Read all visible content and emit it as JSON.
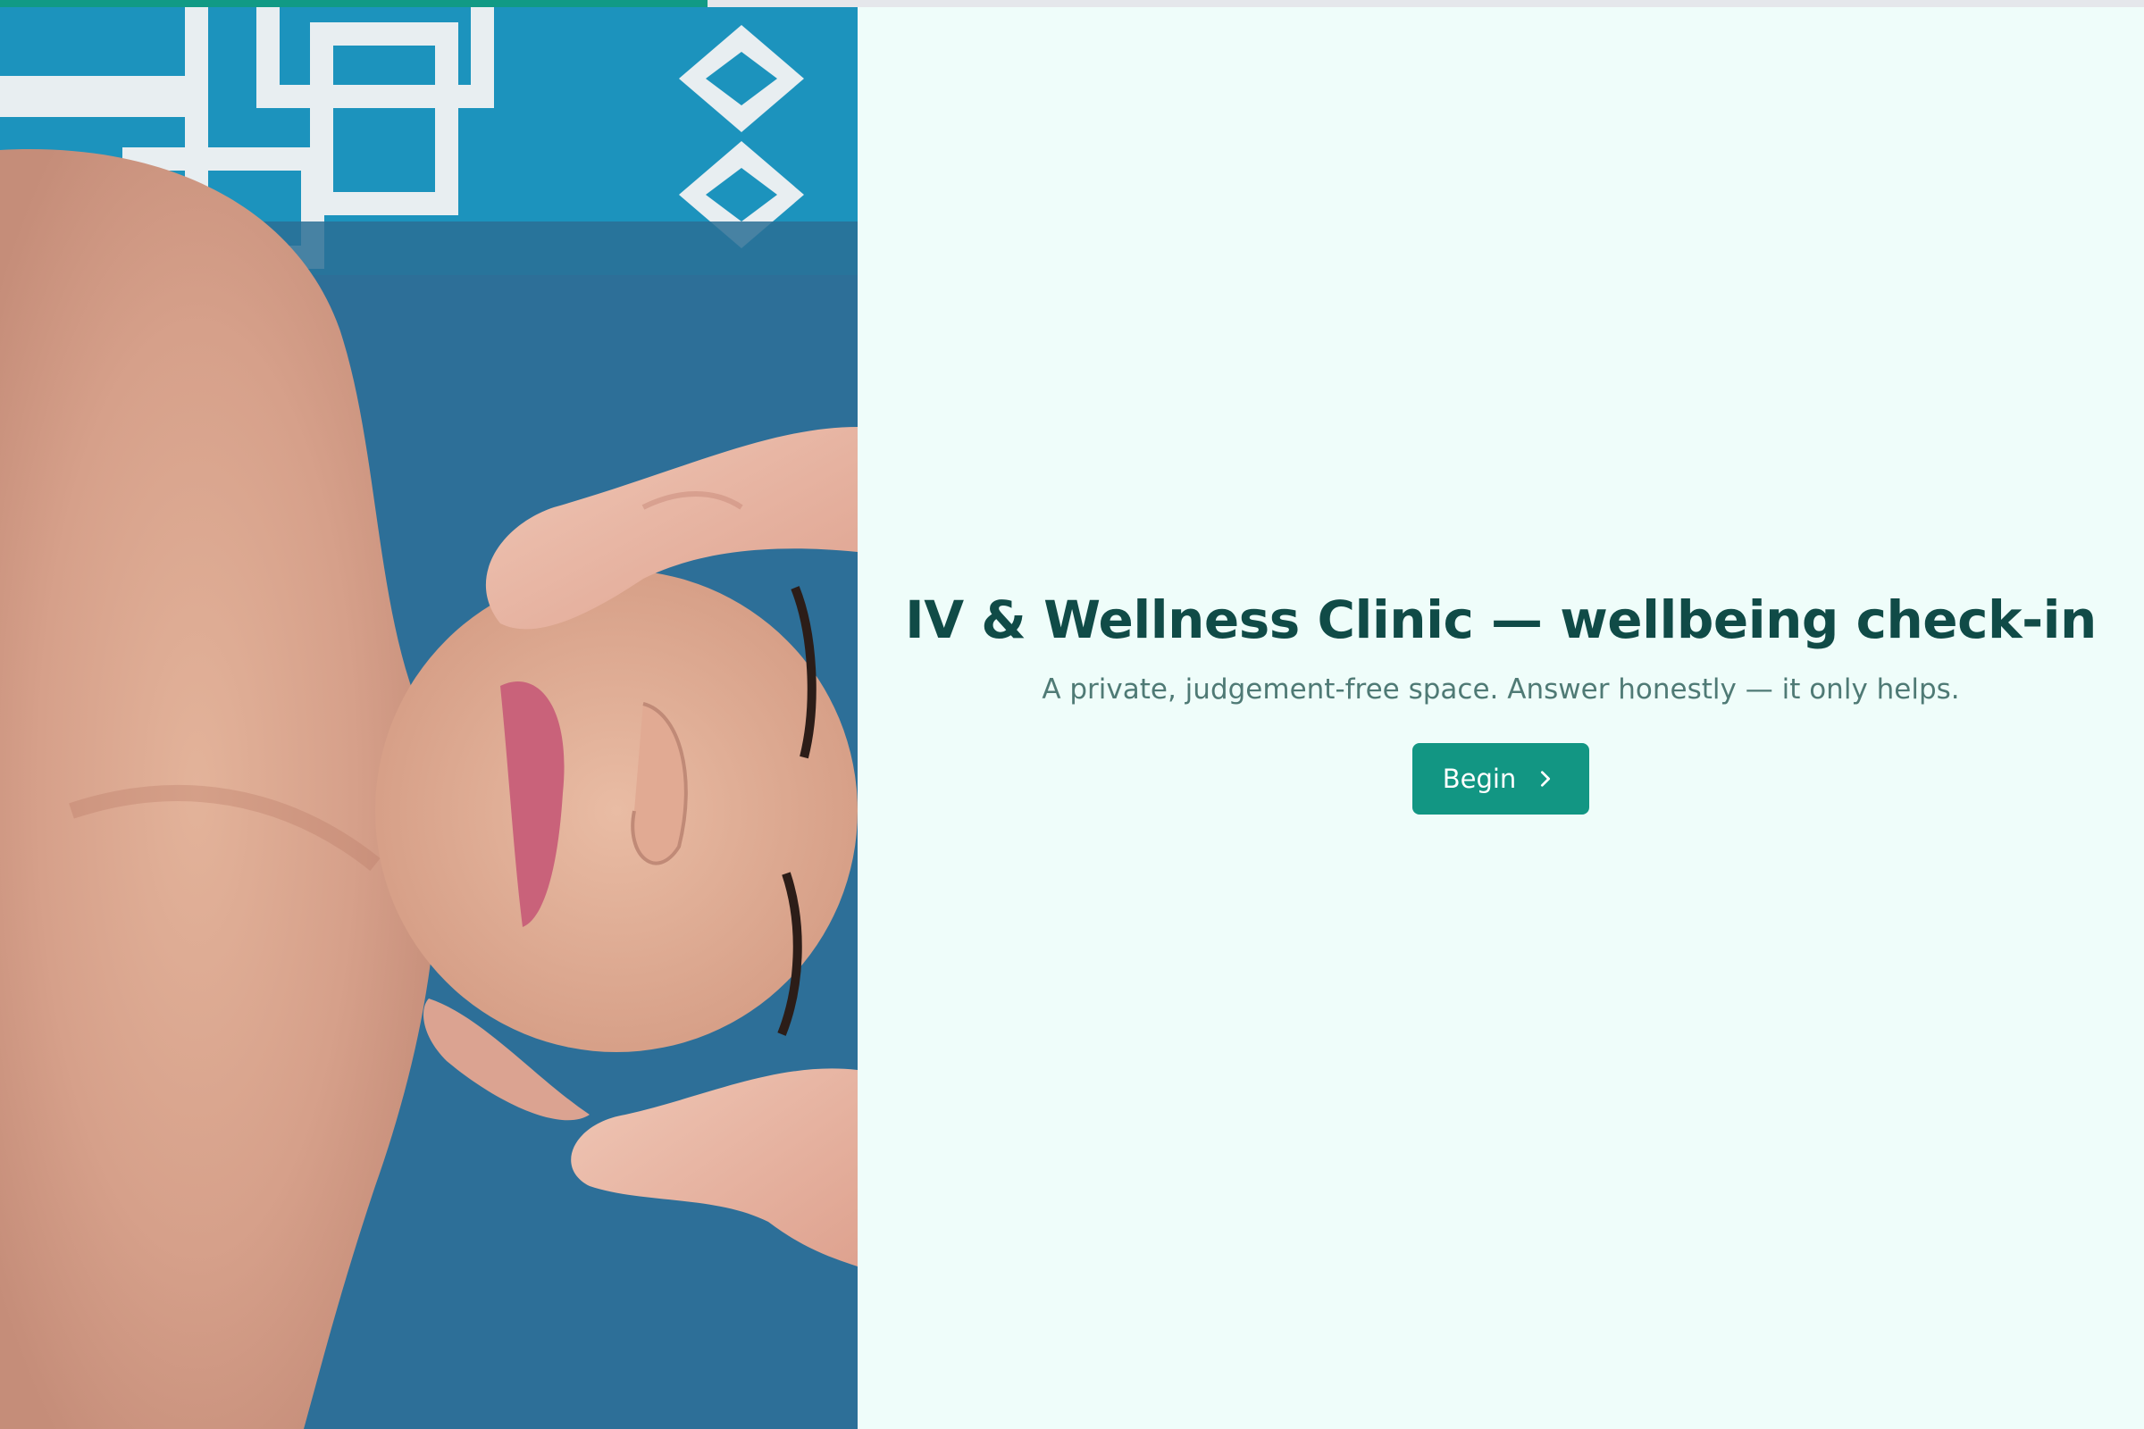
{
  "progress": {
    "fraction": 0.33,
    "fill_color": "#119a85",
    "track_color": "#e5e7eb"
  },
  "hero_image": {
    "icon": "photo-placeholder"
  },
  "intro": {
    "title": "IV & Wellness Clinic — wellbeing check-in",
    "subtitle": "A private, judgement-free space. Answer honestly — it only helps.",
    "begin_label": "Begin",
    "begin_icon": "chevron-right-icon"
  },
  "colors": {
    "background": "#effdfa",
    "title": "#104b47",
    "subtitle": "#4f7a75",
    "accent": "#129683"
  }
}
